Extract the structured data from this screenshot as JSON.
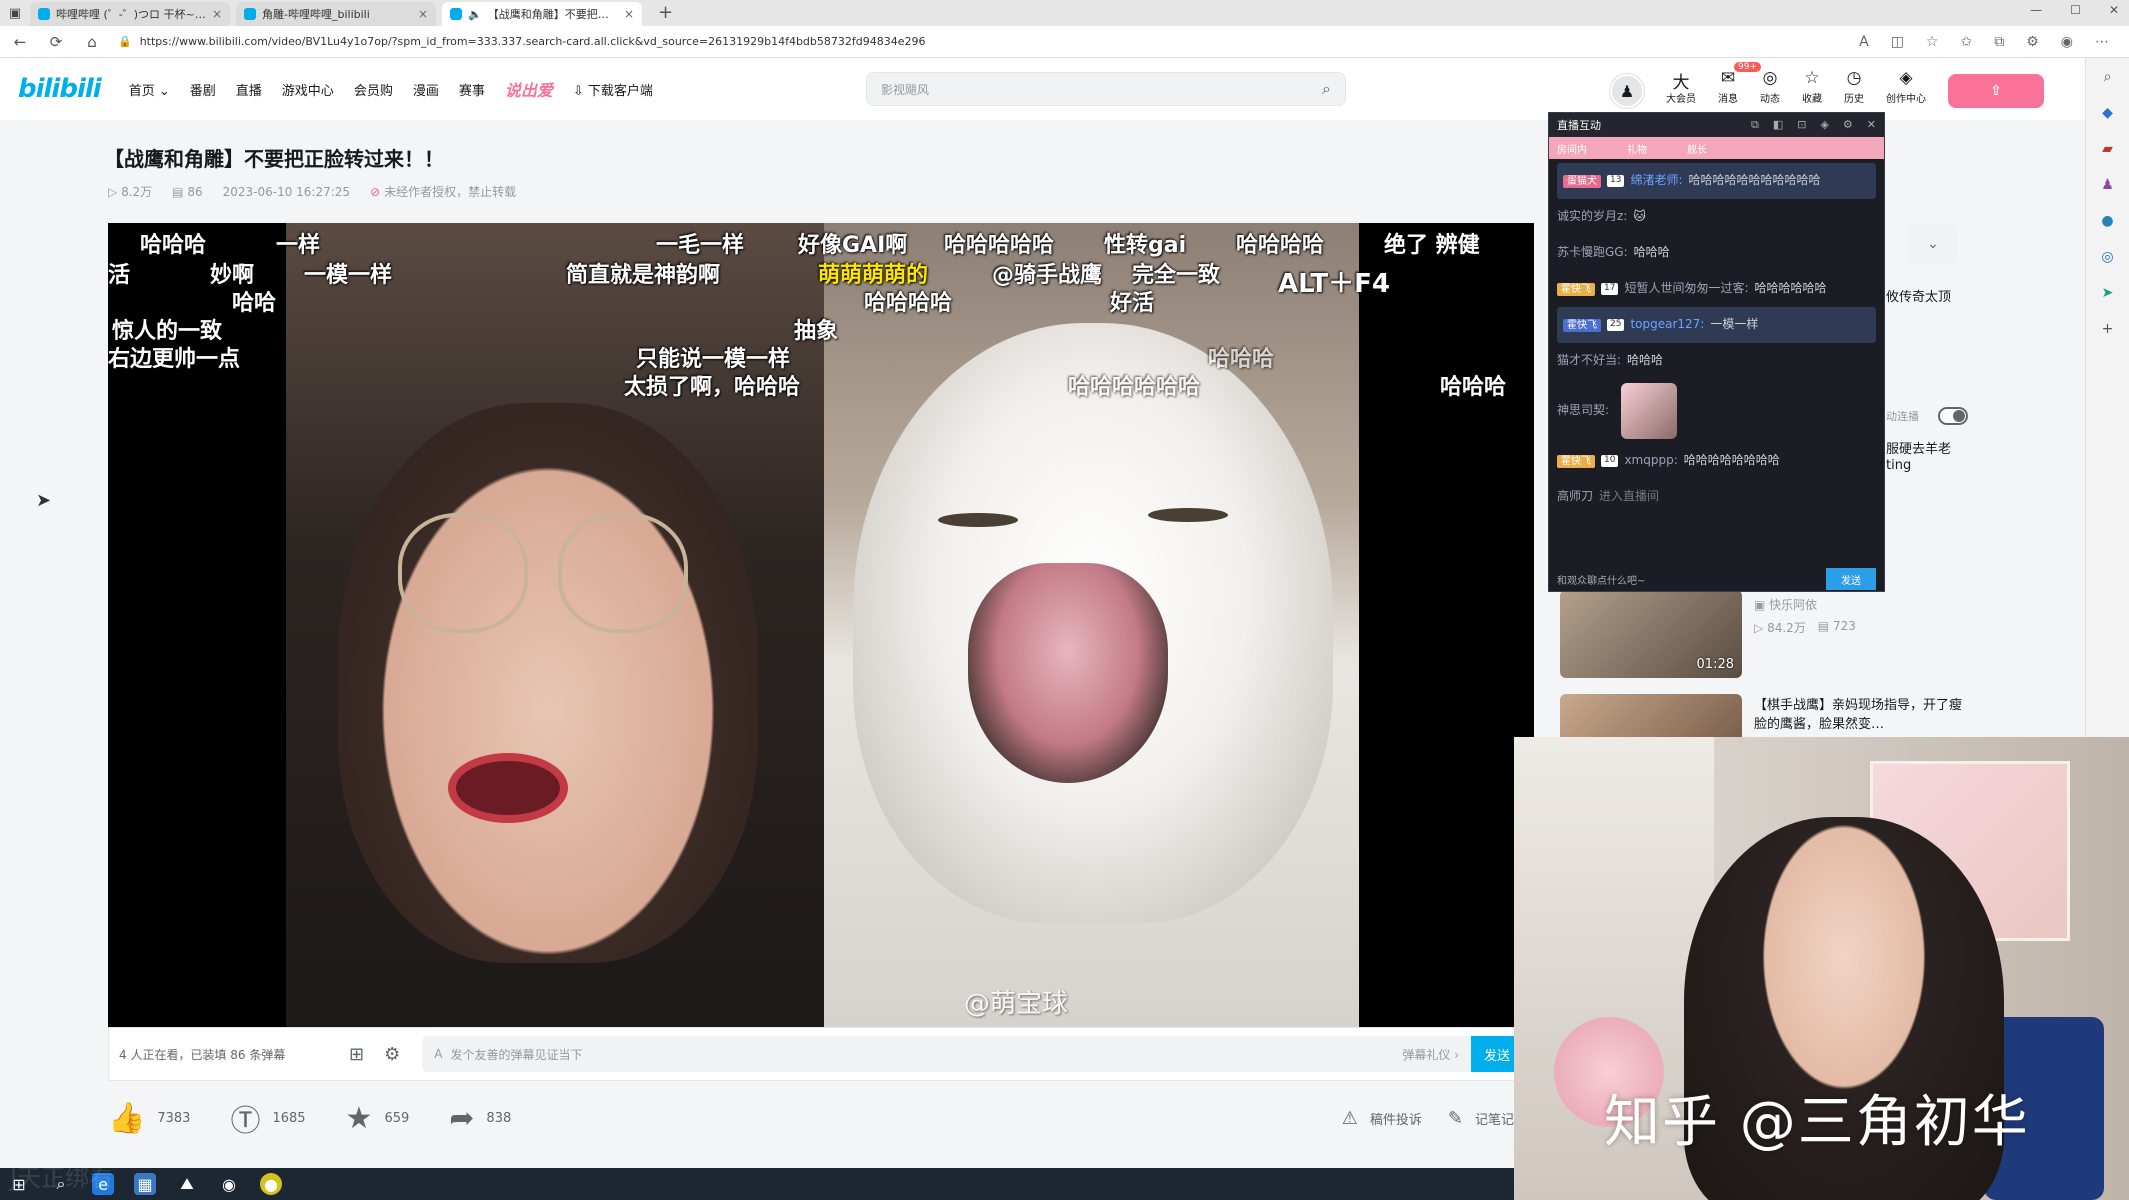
{
  "browser": {
    "tabs": [
      {
        "label": "哔哩哔哩 (゜-゜)つロ 干杯~-bili",
        "close": "×"
      },
      {
        "label": "角雕-哔哩哔哩_bilibili",
        "close": "×"
      },
      {
        "label": "【战鹰和角雕】不要把正脸",
        "close": "×"
      }
    ],
    "new_tab": "+",
    "url": "https://www.bilibili.com/video/BV1Lu4y1o7op/?spm_id_from=333.337.search-card.all.click&vd_source=26131929b14f4bdb58732fd94834e296"
  },
  "header": {
    "logo": "bilibili",
    "nav": [
      "首页",
      "番剧",
      "直播",
      "游戏中心",
      "会员购",
      "漫画",
      "赛事"
    ],
    "hot": "说出爱",
    "download": "下载客户端",
    "search_placeholder": "影视飓风",
    "right_items": [
      {
        "icon": "大",
        "label": "大会员"
      },
      {
        "icon": "✉",
        "label": "消息",
        "badge": "99+"
      },
      {
        "icon": "◎",
        "label": "动态"
      },
      {
        "icon": "☆",
        "label": "收藏"
      },
      {
        "icon": "◷",
        "label": "历史"
      },
      {
        "icon": "◈",
        "label": "创作中心"
      }
    ]
  },
  "video": {
    "title": "【战鹰和角雕】不要把正脸转过来！！",
    "views": "8.2万",
    "danmaku_count": "86",
    "date": "2023-06-10 16:27:25",
    "copyright": "未经作者授权，禁止转载",
    "danmaku": [
      {
        "text": "哈哈哈",
        "color": "white"
      },
      {
        "text": "一样",
        "color": "white"
      },
      {
        "text": "一毛一样",
        "color": "white"
      },
      {
        "text": "好像GAI啊",
        "color": "white"
      },
      {
        "text": "哈哈哈哈哈",
        "color": "white"
      },
      {
        "text": "性转gai",
        "color": "white"
      },
      {
        "text": "哈哈哈哈",
        "color": "white"
      },
      {
        "text": "绝了 辨健",
        "color": "white"
      },
      {
        "text": "活",
        "color": "white"
      },
      {
        "text": "妙啊",
        "color": "white"
      },
      {
        "text": "一模一样",
        "color": "white"
      },
      {
        "text": "简直就是神韵啊",
        "color": "white"
      },
      {
        "text": "萌萌萌萌的",
        "color": "yellow"
      },
      {
        "text": "@骑手战鹰",
        "color": "white"
      },
      {
        "text": "完全一致",
        "color": "white"
      },
      {
        "text": "ALT＋F4",
        "color": "white"
      },
      {
        "text": "哈哈",
        "color": "white"
      },
      {
        "text": "哈哈哈哈",
        "color": "white"
      },
      {
        "text": "好活",
        "color": "white"
      },
      {
        "text": "惊人的一致",
        "color": "white"
      },
      {
        "text": "抽象",
        "color": "white"
      },
      {
        "text": "右边更帅一点",
        "color": "white"
      },
      {
        "text": "只能说一模一样",
        "color": "white"
      },
      {
        "text": "太损了啊，哈哈哈",
        "color": "white"
      },
      {
        "text": "哈哈哈",
        "color": "white"
      },
      {
        "text": "哈哈哈哈哈哈",
        "color": "white"
      },
      {
        "text": "哈哈哈",
        "color": "white"
      }
    ],
    "inner_watermark": "@萌宝球"
  },
  "controlbar": {
    "viewers": "4 人正在看，已装填 86 条弹幕",
    "danmaku_placeholder": "发个友善的弹幕见证当下",
    "etiquette": "弹幕礼仪 ›",
    "send": "发送"
  },
  "actions": {
    "like": "7383",
    "coin": "1685",
    "favorite": "659",
    "share": "838",
    "report": "稿件投诉",
    "note": "记笔记"
  },
  "sidebar": {
    "peek_texts": [
      "攸传奇太顶",
      "动连播",
      "服硬去羊老",
      "ting"
    ],
    "recs": [
      {
        "title": "",
        "up": "快乐阿依",
        "views": "84.2万",
        "danmaku": "723",
        "duration": "01:28"
      },
      {
        "title": "【棋手战鹰】亲妈现场指导，开了瘦脸的鹰酱，脸果然变…",
        "up": "",
        "views": "",
        "danmaku": "",
        "duration": ""
      }
    ]
  },
  "chat": {
    "title": "直播互动",
    "tabs": [
      "房间内",
      "礼物",
      "舰长"
    ],
    "messages": [
      {
        "medal": "蛋猫犬",
        "level": "13",
        "user": "绵渚老师:",
        "text": "哈哈哈哈哈哈哈哈哈哈哈",
        "highlight": true
      },
      {
        "medal": "",
        "level": "",
        "user": "诚实的岁月z:",
        "text": "🐱",
        "highlight": false
      },
      {
        "medal": "",
        "level": "",
        "user": "苏卡慢跑GG:",
        "text": "哈哈哈",
        "highlight": false
      },
      {
        "medal": "霍快飞",
        "level": "17",
        "user": "短暂人世间匆匆一过客:",
        "text": "哈哈哈哈哈哈",
        "highlight": false
      },
      {
        "medal": "霍快飞",
        "level": "25",
        "user": "topgear127:",
        "text": "一模一样",
        "highlight": true
      },
      {
        "medal": "",
        "level": "",
        "user": "猫才不好当:",
        "text": "哈哈哈",
        "highlight": false
      },
      {
        "medal": "",
        "level": "",
        "user": "神思司契:",
        "text": "",
        "highlight": false
      },
      {
        "medal": "霍快飞",
        "level": "10",
        "user": "xmqppp:",
        "text": "哈哈哈哈哈哈哈哈",
        "highlight": false
      },
      {
        "medal": "",
        "level": "",
        "user": "高师刀",
        "text": "进入直播间",
        "highlight": false
      }
    ],
    "input_placeholder": "和观众聊点什么吧~",
    "send": "发送"
  },
  "webcam": {
    "watermark": "知乎 @三角初华"
  },
  "taskbar": {
    "faded_text": "J天正绑看"
  }
}
